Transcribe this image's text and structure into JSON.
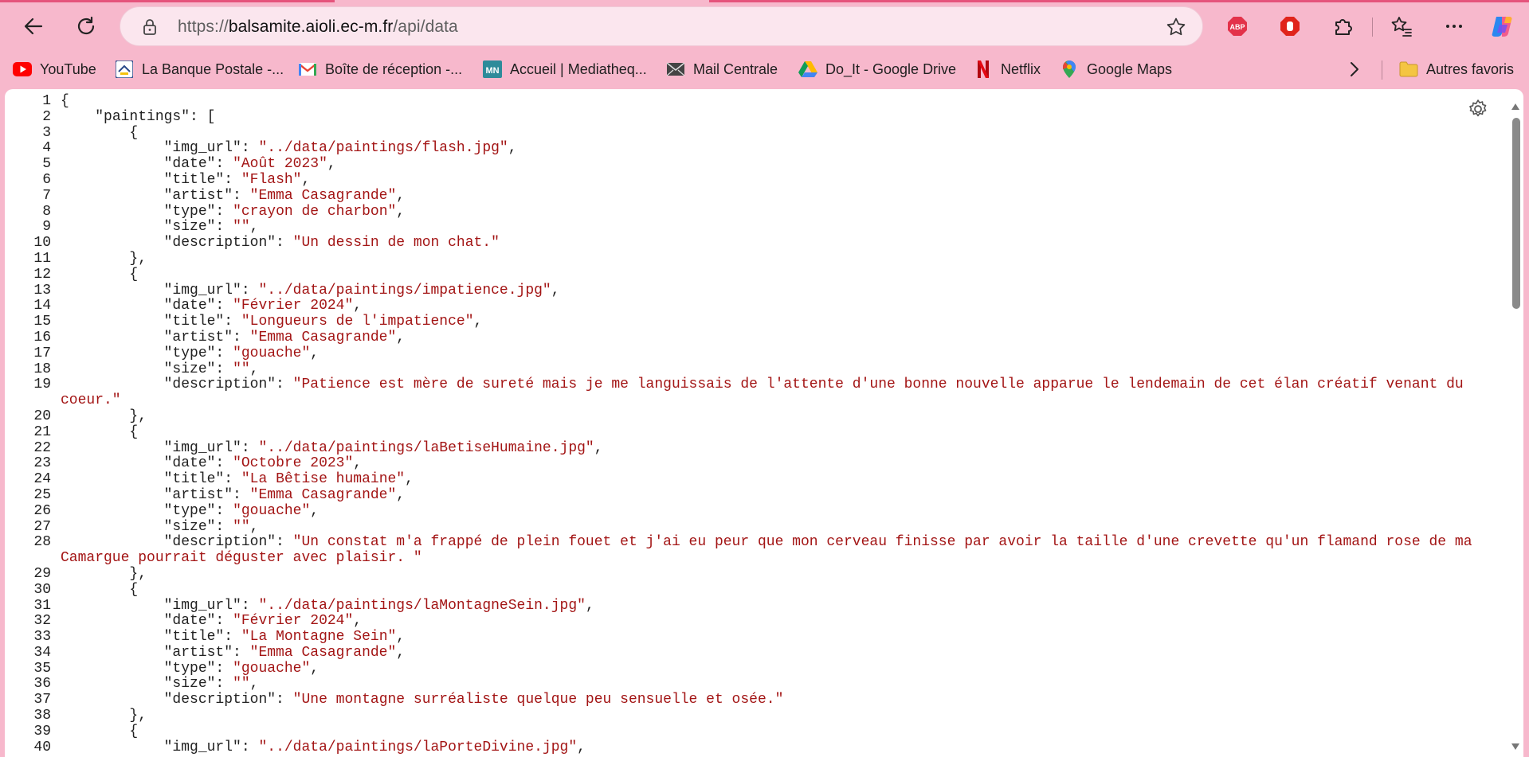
{
  "browser": {
    "url_scheme": "https://",
    "url_host": "balsamite.aioli.ec-m.fr",
    "url_path": "/api/data",
    "colors": {
      "chrome": "#f7b8cc",
      "accent": "#e5547c",
      "string": "#a31515"
    }
  },
  "bookmarks": [
    {
      "label": "YouTube",
      "icon": "youtube-icon"
    },
    {
      "label": "La Banque Postale -...",
      "icon": "banque-postale-icon"
    },
    {
      "label": "Boîte de réception -...",
      "icon": "gmail-icon"
    },
    {
      "label": "Accueil | Mediatheq...",
      "icon": "mediatheque-icon"
    },
    {
      "label": "Mail Centrale",
      "icon": "mail-icon"
    },
    {
      "label": "Do_It - Google Drive",
      "icon": "google-drive-icon"
    },
    {
      "label": "Netflix",
      "icon": "netflix-icon"
    },
    {
      "label": "Google Maps",
      "icon": "google-maps-icon"
    }
  ],
  "bookmarks_overflow": {
    "label": "Autres favoris",
    "icon": "folder-icon"
  },
  "lines": [
    "{",
    "    \"paintings\": [",
    "        {",
    "            \"img_url\": \"../data/paintings/flash.jpg\",",
    "            \"date\": \"Août 2023\",",
    "            \"title\": \"Flash\",",
    "            \"artist\": \"Emma Casagrande\",",
    "            \"type\": \"crayon de charbon\",",
    "            \"size\": \"\",",
    "            \"description\": \"Un dessin de mon chat.\"",
    "        },",
    "        {",
    "            \"img_url\": \"../data/paintings/impatience.jpg\",",
    "            \"date\": \"Février 2024\",",
    "            \"title\": \"Longueurs de l'impatience\",",
    "            \"artist\": \"Emma Casagrande\",",
    "            \"type\": \"gouache\",",
    "            \"size\": \"\",",
    "            \"description\": \"Patience est mère de sureté mais je me languissais de l'attente d'une bonne nouvelle apparue le lendemain de cet élan créatif venant du coeur.\"",
    "        },",
    "        {",
    "            \"img_url\": \"../data/paintings/laBetiseHumaine.jpg\",",
    "            \"date\": \"Octobre 2023\",",
    "            \"title\": \"La Bêtise humaine\",",
    "            \"artist\": \"Emma Casagrande\",",
    "            \"type\": \"gouache\",",
    "            \"size\": \"\",",
    "            \"description\": \"Un constat m'a frappé de plein fouet et j'ai eu peur que mon cerveau finisse par avoir la taille d'une crevette qu'un flamand rose de ma Camargue pourrait déguster avec plaisir. \"",
    "        },",
    "        {",
    "            \"img_url\": \"../data/paintings/laMontagneSein.jpg\",",
    "            \"date\": \"Février 2024\",",
    "            \"title\": \"La Montagne Sein\",",
    "            \"artist\": \"Emma Casagrande\",",
    "            \"type\": \"gouache\",",
    "            \"size\": \"\",",
    "            \"description\": \"Une montagne surréaliste quelque peu sensuelle et osée.\"",
    "        },",
    "        {",
    "            \"img_url\": \"../data/paintings/laPorteDivine.jpg\","
  ]
}
